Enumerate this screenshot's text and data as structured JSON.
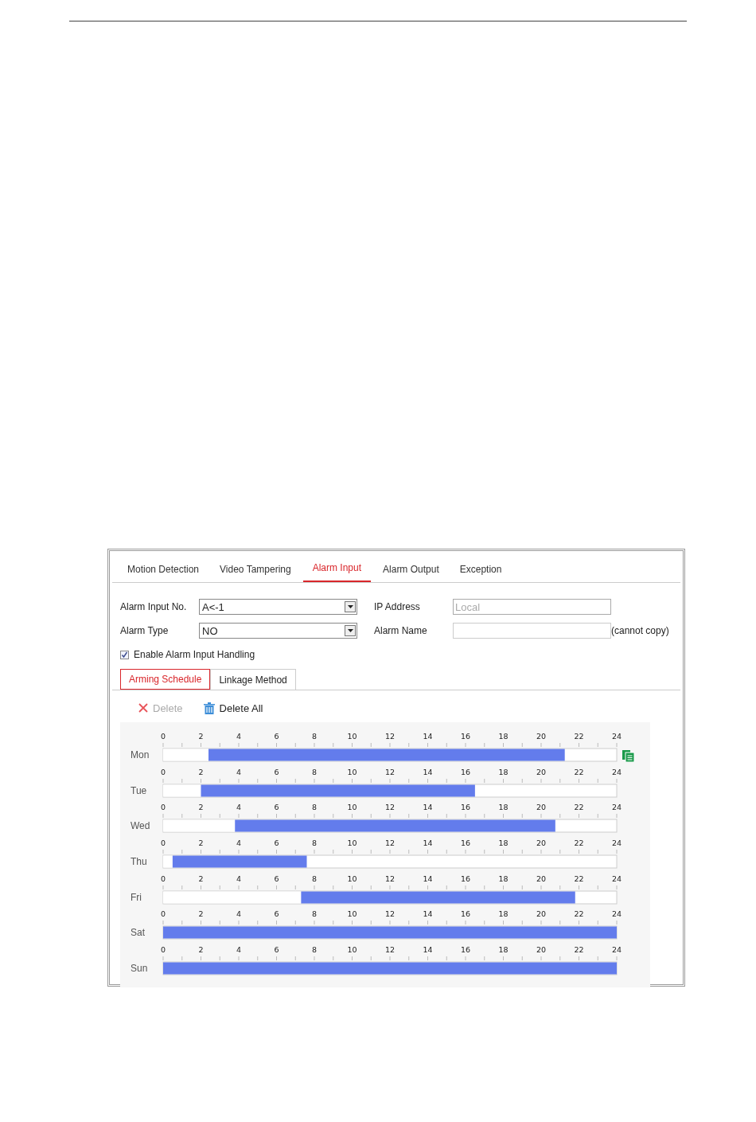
{
  "tabs": [
    {
      "label": "Motion Detection",
      "selected": false
    },
    {
      "label": "Video Tampering",
      "selected": false
    },
    {
      "label": "Alarm Input",
      "selected": true
    },
    {
      "label": "Alarm Output",
      "selected": false
    },
    {
      "label": "Exception",
      "selected": false
    }
  ],
  "form": {
    "alarm_input_no": {
      "label": "Alarm Input No.",
      "value": "A<-1"
    },
    "alarm_type": {
      "label": "Alarm Type",
      "value": "NO"
    },
    "ip_address": {
      "label": "IP Address",
      "value": "Local",
      "disabled": true
    },
    "alarm_name": {
      "label": "Alarm Name",
      "note": "(cannot copy)"
    }
  },
  "enable_handling": {
    "label": "Enable Alarm Input Handling",
    "checked": true
  },
  "subtabs": [
    {
      "label": "Arming Schedule",
      "selected": true
    },
    {
      "label": "Linkage Method",
      "selected": false
    }
  ],
  "toolbar": [
    {
      "label": "Delete",
      "kind": "delete",
      "disabled": true
    },
    {
      "label": "Delete All",
      "kind": "delete_all",
      "disabled": false
    }
  ],
  "schedule": [
    {
      "chart_data": {
        "type": "bar",
        "orientation": "horizontal",
        "stacked": true,
        "categories": [
          "Mon"
        ],
        "xlim": [
          0,
          24
        ],
        "xticks": [
          0,
          2,
          4,
          6,
          8,
          10,
          12,
          14,
          16,
          18,
          20,
          22,
          24
        ],
        "series": [
          {
            "color": "#ffffff",
            "values": [
              2.4
            ]
          },
          {
            "color": "#637cec",
            "values": [
              18.85
            ]
          }
        ]
      }
    },
    {
      "chart_data": {
        "type": "bar",
        "orientation": "horizontal",
        "stacked": true,
        "categories": [
          "Tue"
        ],
        "xlim": [
          0,
          24
        ],
        "xticks": [
          0,
          2,
          4,
          6,
          8,
          10,
          12,
          14,
          16,
          18,
          20,
          22,
          24
        ],
        "series": [
          {
            "color": "#ffffff",
            "values": [
              2.0
            ]
          },
          {
            "color": "#637cec",
            "values": [
              14.5
            ]
          }
        ]
      }
    },
    {
      "chart_data": {
        "type": "bar",
        "orientation": "horizontal",
        "stacked": true,
        "categories": [
          "Wed"
        ],
        "xlim": [
          0,
          24
        ],
        "xticks": [
          0,
          2,
          4,
          6,
          8,
          10,
          12,
          14,
          16,
          18,
          20,
          22,
          24
        ],
        "series": [
          {
            "color": "#ffffff",
            "values": [
              3.8
            ]
          },
          {
            "color": "#637cec",
            "values": [
              16.95
            ]
          }
        ]
      }
    },
    {
      "chart_data": {
        "type": "bar",
        "orientation": "horizontal",
        "stacked": true,
        "categories": [
          "Thu"
        ],
        "xlim": [
          0,
          24
        ],
        "xticks": [
          0,
          2,
          4,
          6,
          8,
          10,
          12,
          14,
          16,
          18,
          20,
          22,
          24
        ],
        "series": [
          {
            "color": "#ffffff",
            "values": [
              0.5
            ]
          },
          {
            "color": "#637cec",
            "values": [
              7.1
            ]
          }
        ]
      }
    },
    {
      "chart_data": {
        "type": "bar",
        "orientation": "horizontal",
        "stacked": true,
        "categories": [
          "Fri"
        ],
        "xlim": [
          0,
          24
        ],
        "xticks": [
          0,
          2,
          4,
          6,
          8,
          10,
          12,
          14,
          16,
          18,
          20,
          22,
          24
        ],
        "series": [
          {
            "color": "#ffffff",
            "values": [
              7.3
            ]
          },
          {
            "color": "#637cec",
            "values": [
              14.5
            ]
          }
        ]
      }
    },
    {
      "chart_data": {
        "type": "bar",
        "orientation": "horizontal",
        "stacked": true,
        "categories": [
          "Sat"
        ],
        "xlim": [
          0,
          24
        ],
        "xticks": [
          0,
          2,
          4,
          6,
          8,
          10,
          12,
          14,
          16,
          18,
          20,
          22,
          24
        ],
        "series": [
          {
            "color": "#ffffff",
            "values": [
              0
            ]
          },
          {
            "color": "#637cec",
            "values": [
              24
            ]
          }
        ]
      }
    },
    {
      "chart_data": {
        "type": "bar",
        "orientation": "horizontal",
        "stacked": true,
        "categories": [
          "Sun"
        ],
        "xlim": [
          0,
          24
        ],
        "xticks": [
          0,
          2,
          4,
          6,
          8,
          10,
          12,
          14,
          16,
          18,
          20,
          22,
          24
        ],
        "series": [
          {
            "color": "#ffffff",
            "values": [
              0
            ]
          },
          {
            "color": "#637cec",
            "values": [
              24
            ]
          }
        ]
      }
    }
  ]
}
